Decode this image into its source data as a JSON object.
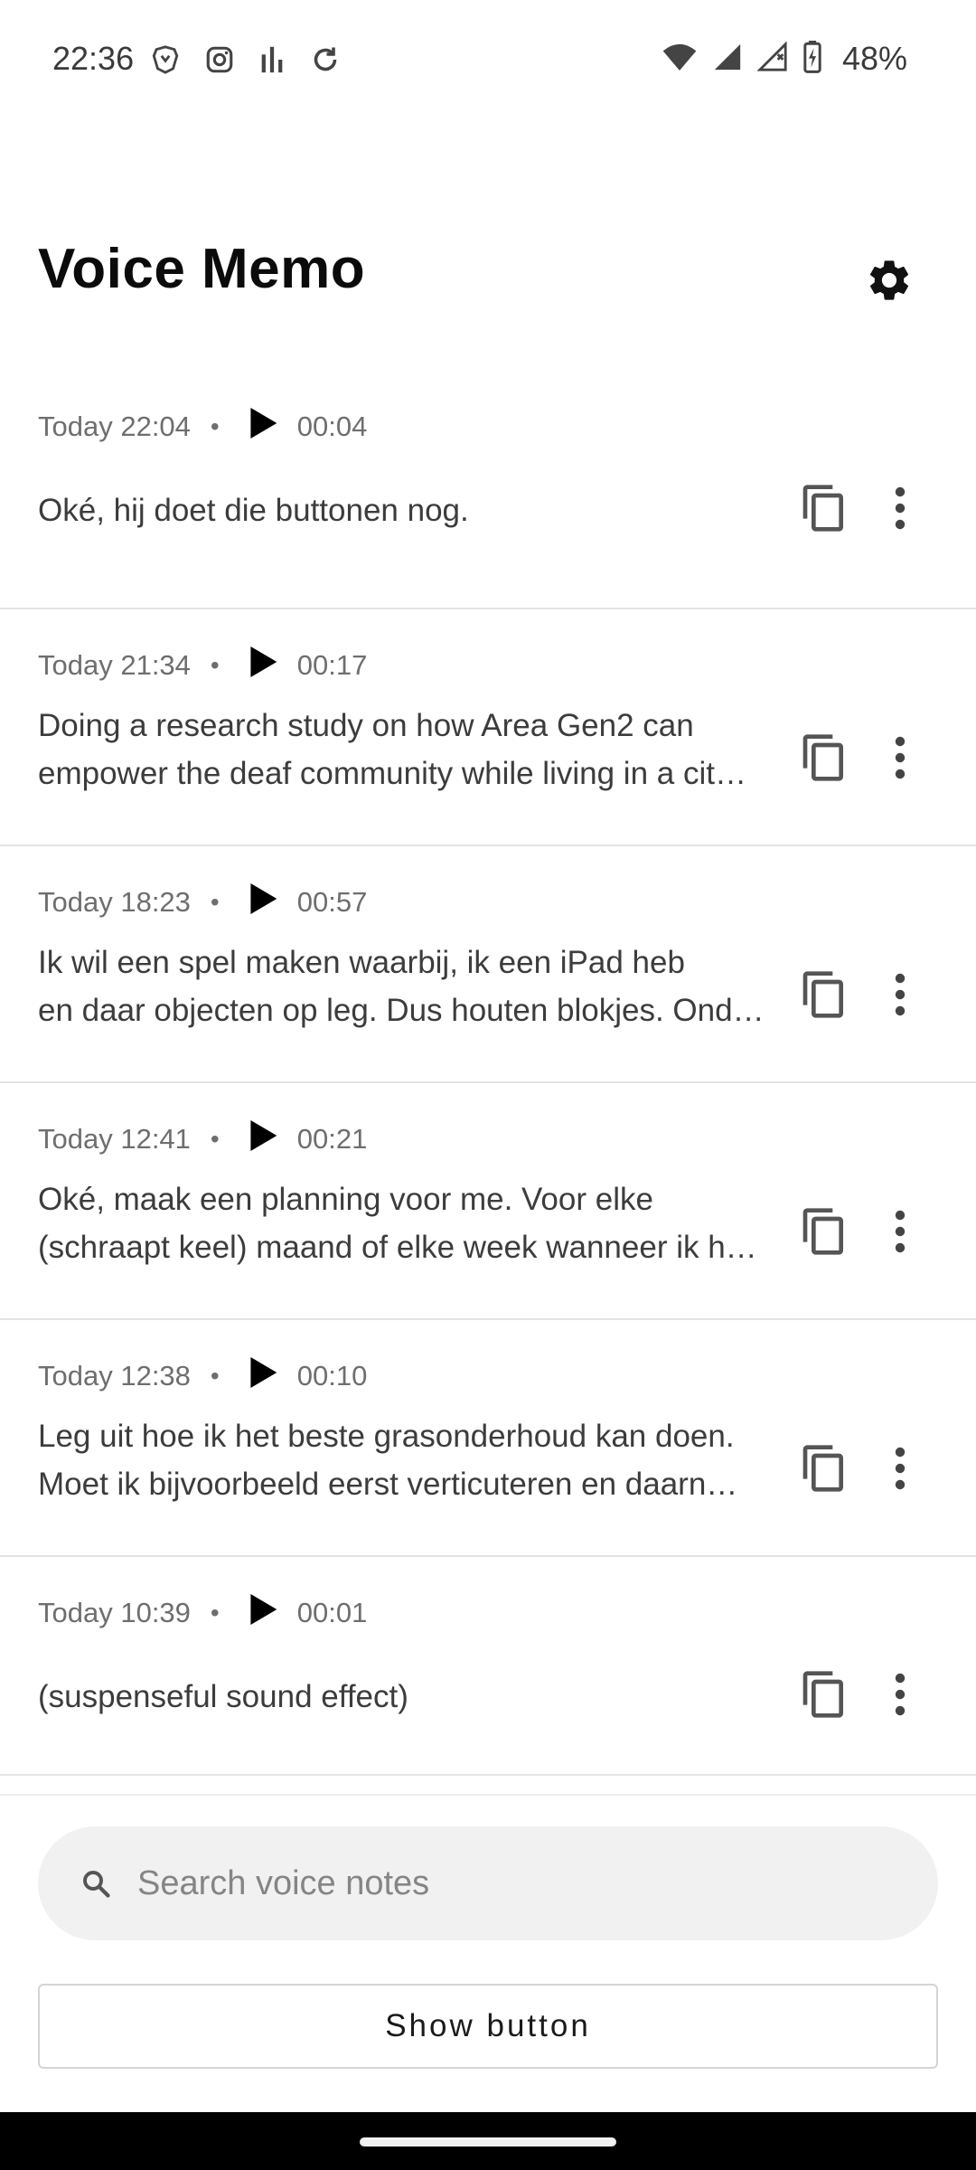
{
  "status_bar": {
    "time": "22:36",
    "left_icons": [
      "brave-icon",
      "instagram-icon",
      "bar-chart-icon",
      "sync-icon"
    ],
    "right_icons": [
      "wifi-icon",
      "signal-icon",
      "signal-no-service-icon",
      "battery-charging-icon"
    ],
    "battery": "48%"
  },
  "header": {
    "title": "Voice Memo",
    "settings_icon": "gear-icon"
  },
  "memos": [
    {
      "timestamp": "Today 22:04",
      "separator": "•",
      "duration": "00:04",
      "lines": [
        "Oké, hij doet die buttonen nog."
      ]
    },
    {
      "timestamp": "Today 21:34",
      "separator": "•",
      "duration": "00:17",
      "lines": [
        "Doing a research study on how Area Gen2 can",
        "empower the deaf community while living in a cit…"
      ]
    },
    {
      "timestamp": "Today 18:23",
      "separator": "•",
      "duration": "00:57",
      "lines": [
        "Ik wil een spel maken waarbij, ik een iPad heb",
        "en daar objecten op leg. Dus houten blokjes. Ond…"
      ]
    },
    {
      "timestamp": "Today 12:41",
      "separator": "•",
      "duration": "00:21",
      "lines": [
        "Oké, maak een planning voor me. Voor elke",
        "(schraapt keel) maand of elke week wanneer ik h…"
      ]
    },
    {
      "timestamp": "Today 12:38",
      "separator": "•",
      "duration": "00:10",
      "lines": [
        "Leg uit hoe ik het beste grasonderhoud kan doen.",
        "Moet ik bijvoorbeeld eerst verticuteren en daarn…"
      ]
    },
    {
      "timestamp": "Today 10:39",
      "separator": "•",
      "duration": "00:01",
      "lines": [
        "(suspenseful sound effect)"
      ]
    }
  ],
  "search": {
    "placeholder": "Search voice notes",
    "value": ""
  },
  "actions": {
    "show_button_label": "Show button"
  }
}
